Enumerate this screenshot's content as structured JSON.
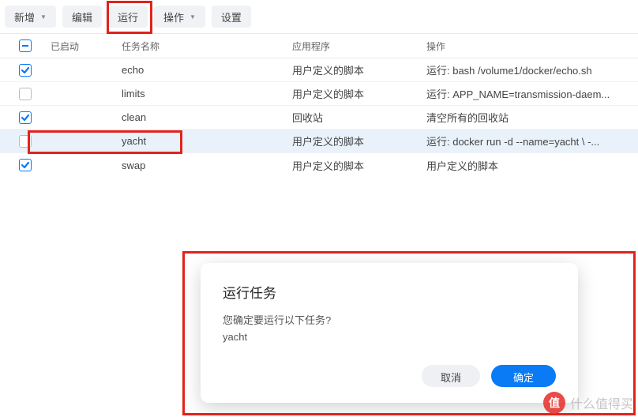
{
  "toolbar": {
    "new": "新增",
    "edit": "编辑",
    "run": "运行",
    "action": "操作",
    "settings": "设置"
  },
  "columns": {
    "enabled": "已启动",
    "name": "任务名称",
    "app": "应用程序",
    "operation": "操作"
  },
  "rows": [
    {
      "checked": true,
      "name": "echo",
      "app": "用户定义的脚本",
      "op": "运行: bash /volume1/docker/echo.sh",
      "selected": false
    },
    {
      "checked": false,
      "name": "limits",
      "app": "用户定义的脚本",
      "op": "运行: APP_NAME=transmission-daem...",
      "selected": false
    },
    {
      "checked": true,
      "name": "clean",
      "app": "回收站",
      "op": "清空所有的回收站",
      "selected": false
    },
    {
      "checked": false,
      "name": "yacht",
      "app": "用户定义的脚本",
      "op": "运行: docker run -d --name=yacht \\ -...",
      "selected": true
    },
    {
      "checked": true,
      "name": "swap",
      "app": "用户定义的脚本",
      "op": "用户定义的脚本",
      "selected": false
    }
  ],
  "dialog": {
    "title": "运行任务",
    "message": "您确定要运行以下任务?",
    "task": "yacht",
    "cancel": "取消",
    "ok": "确定"
  },
  "watermark": {
    "logo": "值",
    "text": "什么值得买"
  }
}
